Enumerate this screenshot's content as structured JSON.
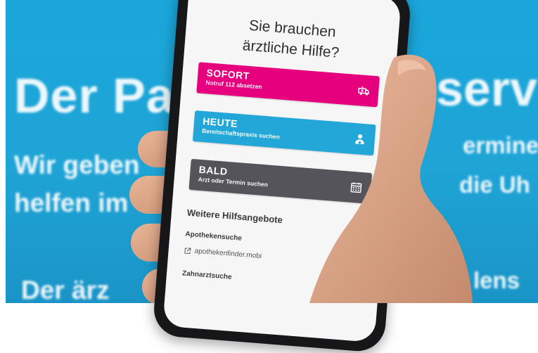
{
  "background": {
    "line1_left": "Der Pa",
    "line1_right": "serv",
    "line2_left": "Wir geben",
    "line2_right": "ermine",
    "line3_left": "helfen im",
    "line3_right": "die Uh",
    "line4_left": "Der ärz",
    "line4_right": "lens"
  },
  "app": {
    "heading_line1": "Sie brauchen",
    "heading_line2": "ärztliche Hilfe?",
    "cards": [
      {
        "title": "SOFORT",
        "subtitle": "Notruf 112 absetzen",
        "color": "#e6007e",
        "icon": "ambulance-icon"
      },
      {
        "title": "HEUTE",
        "subtitle": "Bereitschaftspraxis suchen",
        "color": "#22a7d8",
        "icon": "doctor-icon"
      },
      {
        "title": "BALD",
        "subtitle": "Arzt oder Termin suchen",
        "color": "#55545a",
        "icon": "calendar-icon"
      }
    ],
    "more_title": "Weitere Hilfsangebote",
    "pharmacy_label": "Apothekensuche",
    "pharmacy_link": "apothekenfinder.mobi",
    "dentist_label": "Zahnarztsuche"
  }
}
